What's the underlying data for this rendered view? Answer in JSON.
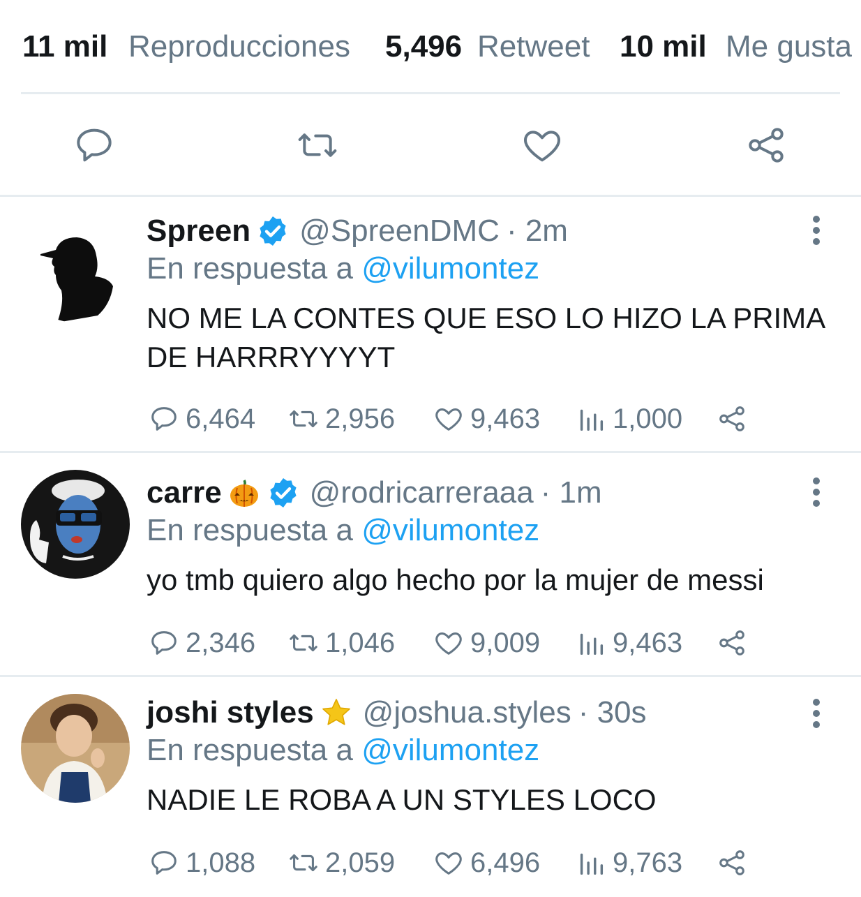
{
  "stats": {
    "views_num": "11 mil",
    "views_label": "Reproducciones",
    "retweets_num": "5,496",
    "retweets_label": "Retweet",
    "likes_num": "10 mil",
    "likes_label": "Me gusta"
  },
  "colors": {
    "accent": "#1da1f2",
    "muted": "#657786",
    "divider": "#e6ecf0",
    "star": "#f5c518",
    "pumpkin": "#f39c12"
  },
  "tweets": [
    {
      "name": "Spreen",
      "badges": [
        "verified"
      ],
      "handle": "@SpreenDMC",
      "time": "· 2m",
      "reply_prefix": "En respuesta a",
      "reply_to": "@vilumontez",
      "text": "NO ME LA CONTES QUE ESO LO HIZO LA PRIMA DE HARRRYYYYT",
      "replies": "6,464",
      "retweets": "2,956",
      "likes": "9,463",
      "views": "1,000"
    },
    {
      "name": "carre",
      "badges": [
        "pumpkin",
        "verified"
      ],
      "handle": "@rodricarreraaa",
      "time": "· 1m",
      "reply_prefix": "En respuesta a",
      "reply_to": "@vilumontez",
      "text": "yo tmb quiero algo hecho por la mujer de messi",
      "replies": "2,346",
      "retweets": "1,046",
      "likes": "9,009",
      "views": "9,463"
    },
    {
      "name": "joshi styles",
      "badges": [
        "star"
      ],
      "handle": "@joshua.styles",
      "time": "· 30s",
      "reply_prefix": "En respuesta a",
      "reply_to": "@vilumontez",
      "text": "NADIE LE ROBA A UN STYLES LOCO",
      "replies": "1,088",
      "retweets": "2,059",
      "likes": "6,496",
      "views": "9,763"
    }
  ]
}
